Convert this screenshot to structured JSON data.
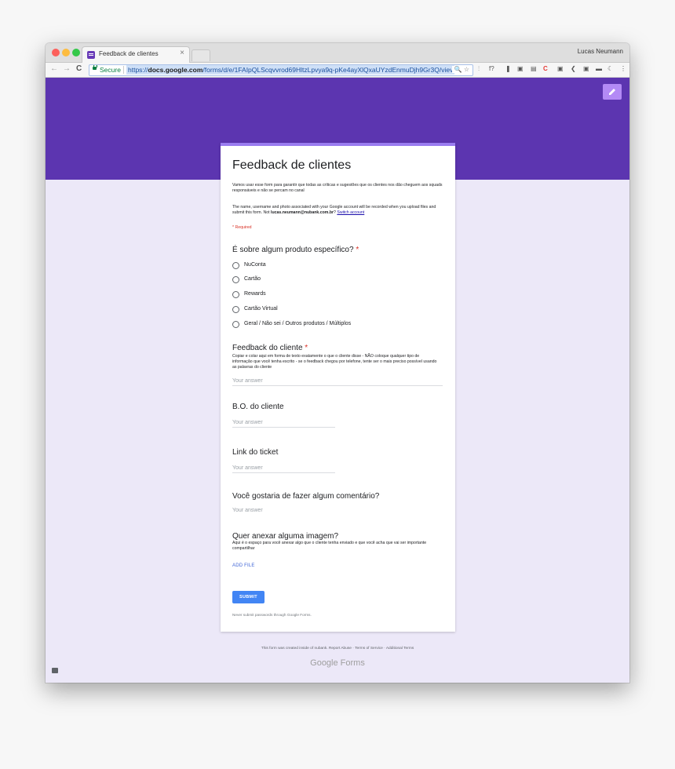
{
  "browser": {
    "tab_title": "Feedback de clientes",
    "tab_close": "×",
    "profile_name": "Lucas Neumann",
    "secure_label": "Secure",
    "url_scheme": "https://",
    "url_host": "docs.google.com",
    "url_path": "/forms/d/e/1FAIpQLScqvvrod69HltzLpvya9q-pKe4ayXlQxaUYzdEnmuDjh9Gr3Q/viev",
    "nav_back": "←",
    "nav_forward": "→",
    "nav_reload": "C",
    "omni_icons": "🔍 ☆",
    "extensions": [
      "⫶",
      "f?",
      "❚",
      "▣",
      "▤",
      "C",
      "▣",
      "❮",
      "▣",
      "▬",
      "☾",
      "⋮"
    ]
  },
  "form": {
    "title": "Feedback de clientes",
    "description": "Vamos usar esse form para garantir que todas as críticas e sugestões que os clientes nos dão cheguem aos squads responsáveis e não se percam no canal",
    "notice_text": "The name, username and photo associated with your Google account will be recorded when you upload files and submit this form. Not ",
    "notice_email": "lucas.neumann@nubank.com.br",
    "notice_q": "? ",
    "switch_account": "Switch account",
    "required_note": "* Required",
    "q1": {
      "title": "É sobre algum produto específico?",
      "star": "*",
      "options": [
        "NuConta",
        "Cartão",
        "Rewards",
        "Cartão Virtual",
        "Geral / Não sei / Outros produtos / Múltiplos"
      ]
    },
    "q2": {
      "title": "Feedback do cliente",
      "star": "*",
      "help": "Copiar e colar aqui em forma de texto exatamente o que o cliente disse - NÃO coloque qualquer tipo de informação que você tenha escrito - se o feedback chegou por telefone, tente ser o mais preciso possível usando as palavras do cliente",
      "placeholder": "Your answer"
    },
    "q3": {
      "title": "B.O. do cliente",
      "placeholder": "Your answer"
    },
    "q4": {
      "title": "Link do ticket",
      "placeholder": "Your answer"
    },
    "q5": {
      "title": "Você gostaria de fazer algum comentário?",
      "placeholder": "Your answer"
    },
    "q6": {
      "title": "Quer anexar alguma imagem?",
      "help": "Aqui é o espaço para você anexar algo que o cliente tenha enviado e que você acha que vai ser importante compartilhar",
      "add_file": "ADD FILE"
    },
    "submit": "SUBMIT",
    "never_submit": "Never submit passwords through Google Forms."
  },
  "footer": {
    "text": "This form was created inside of nubank. Report Abuse · Terms of Service · Additional Terms",
    "brand": "Google Forms"
  },
  "colors": {
    "header": "#5c35b0",
    "page_bg": "#ece8f8",
    "accent": "#9a7cf0",
    "submit": "#4285f4",
    "required": "#d93025"
  }
}
